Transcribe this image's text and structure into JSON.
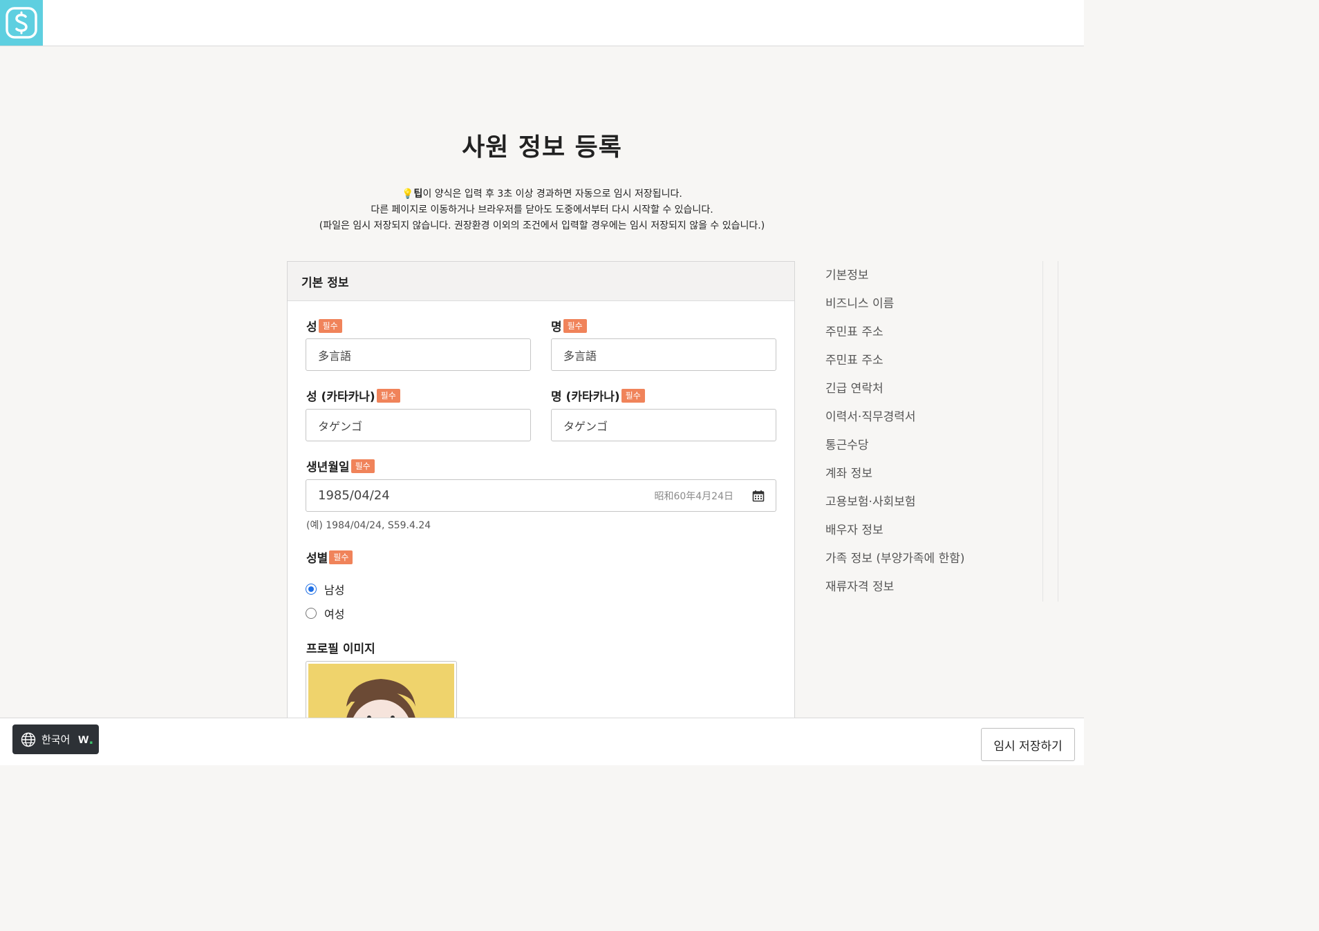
{
  "header": {
    "logo_icon": "s-logo-icon"
  },
  "page": {
    "title": "사원 정보 등록",
    "tip_head": "💡팁",
    "tip_line1": "이 양식은 입력 후 3초 이상 경과하면 자동으로 임시 저장됩니다.",
    "tip_line2": "다른 페이지로 이동하거나 브라우저를 닫아도 도중에서부터 다시 시작할 수 있습니다.",
    "tip_line3": "(파일은 임시 저장되지 않습니다. 권장환경 이외의 조건에서 입력할 경우에는 임시 저장되지 않을 수 있습니다.)"
  },
  "form": {
    "section_title": "기본 정보",
    "required_badge": "필수",
    "last_name": {
      "label": "성",
      "value": "多言語"
    },
    "first_name": {
      "label": "명",
      "value": "多言語"
    },
    "last_name_kana": {
      "label": "성 (카타카나)",
      "value": "タゲンゴ"
    },
    "first_name_kana": {
      "label": "명 (카타카나)",
      "value": "タゲンゴ"
    },
    "birthdate": {
      "label": "생년월일",
      "value": "1985/04/24",
      "era_hint": "昭和60年4月24日",
      "example": "(예) 1984/04/24, S59.4.24",
      "calendar_icon": "calendar-icon"
    },
    "gender": {
      "label": "성별",
      "options": [
        {
          "label": "남성",
          "checked": true
        },
        {
          "label": "여성",
          "checked": false
        }
      ]
    },
    "profile_image": {
      "label": "프로필 이미지"
    }
  },
  "side_nav": {
    "items": [
      "기본정보",
      "비즈니스 이름",
      "주민표 주소",
      "주민표 주소",
      "긴급 연락처",
      "이력서·직무경력서",
      "통근수당",
      "계좌 정보",
      "고용보험·사회보험",
      "배우자 정보",
      "가족 정보 (부양가족에 한함)",
      "재류자격 정보"
    ]
  },
  "footer": {
    "language_label": "한국어",
    "brand": "w",
    "brand_dot": ".",
    "save_label": "임시 저장하기",
    "globe_icon": "globe-icon"
  },
  "colors": {
    "accent_logo": "#5ecfe0",
    "required_badge": "#f0835a",
    "radio_selected": "#1f6fe5",
    "avatar_bg": "#efd36c",
    "footer_dark": "#2d3136"
  }
}
